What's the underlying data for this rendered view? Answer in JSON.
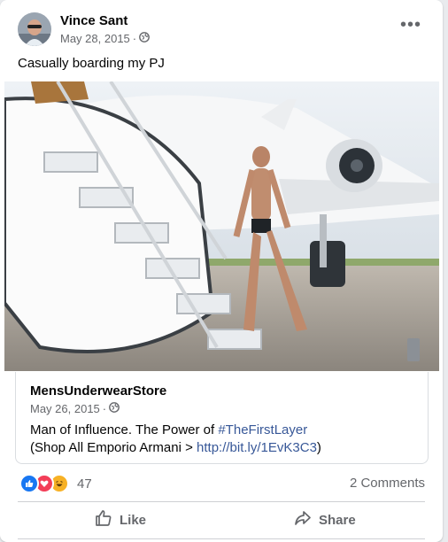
{
  "post": {
    "author": "Vince Sant",
    "date": "May 28, 2015",
    "separator": "·",
    "audience_icon": "globe-icon",
    "caption": "Casually boarding my PJ",
    "more_icon": "more-options-icon",
    "more_label": "•••"
  },
  "shared": {
    "page_name": "MensUnderwearStore",
    "date": "May 26, 2015",
    "separator": "·",
    "text_prefix": "Man of Influence. The Power of ",
    "hashtag": "#TheFirstLayer",
    "line2_prefix": "(Shop All Emporio Armani > ",
    "link": "http://bit.ly/1EvK3C3",
    "line2_suffix": ")"
  },
  "engagement": {
    "reaction_icons": [
      "like-reaction-icon",
      "love-reaction-icon",
      "haha-reaction-icon"
    ],
    "reaction_count": "47",
    "comments": "2 Comments"
  },
  "actions": {
    "like_label": "Like",
    "share_label": "Share"
  },
  "colors": {
    "link": "#385898",
    "like": "#1877f2",
    "love": "#f33e58",
    "haha": "#f7b125"
  }
}
